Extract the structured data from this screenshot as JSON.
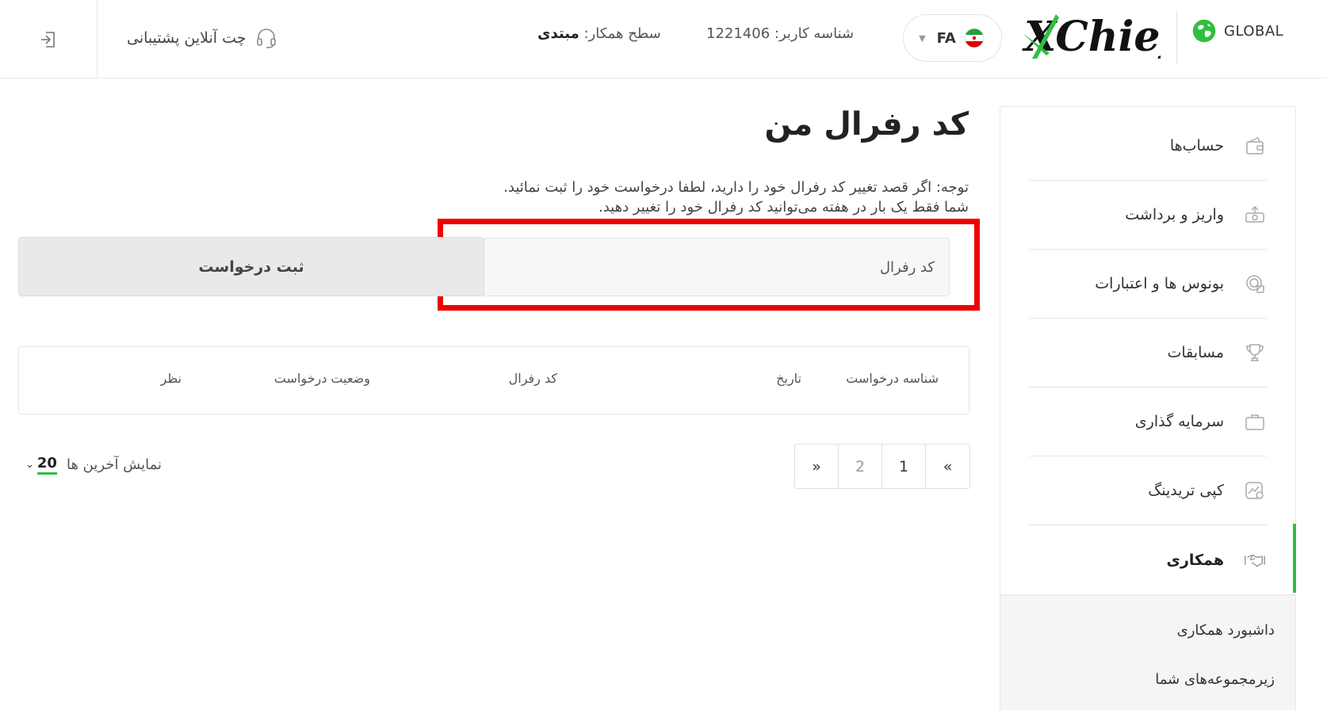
{
  "header": {
    "support_label": "چت آنلاین پشتیبانی",
    "partner_level_label": "سطح همکار:",
    "partner_level_value": "مبتدی",
    "user_id_text": "شناسه کاربر: 1221406",
    "language_code": "FA",
    "logo_text": "XChief",
    "global_label": "GLOBAL",
    "icons": {
      "logout": "logout-icon",
      "support": "headset-icon",
      "flag": "iran-flag-icon",
      "caret": "chevron-down-icon",
      "globe": "globe-icon"
    }
  },
  "main": {
    "title": "کد رفرال من",
    "notice_line1": "توجه: اگر قصد تغییر کد رفرال خود را دارید، لطفا درخواست خود را ثبت نمائید.",
    "notice_line2": "شما فقط یک بار در هفته می‌توانید کد رفرال خود را تغییر دهید.",
    "referral_input_placeholder": "کد رفرال",
    "submit_label": "ثبت درخواست",
    "table_headers": [
      "شناسه درخواست",
      "تاریخ",
      "کد رفرال",
      "وضعیت درخواست",
      "نظر"
    ],
    "pagination": {
      "next": "»",
      "pages": [
        "1",
        "2"
      ],
      "prev": "«"
    },
    "show_last_label": "نمایش آخرین ها",
    "show_last_value": "20"
  },
  "sidebar": {
    "items": [
      {
        "label": "حساب‌ها",
        "icon": "wallet-icon"
      },
      {
        "label": "واریز و برداشت",
        "icon": "money-transfer-icon"
      },
      {
        "label": "بونوس ها و اعتبارات",
        "icon": "bonus-coin-icon"
      },
      {
        "label": "مسابقات",
        "icon": "trophy-icon"
      },
      {
        "label": "سرمایه گذاری",
        "icon": "briefcase-icon"
      },
      {
        "label": "کپی تریدینگ",
        "icon": "copy-trading-icon"
      },
      {
        "label": "همکاری",
        "icon": "handshake-icon"
      }
    ],
    "active_index": 6,
    "submenu": [
      "داشبورد همکاری",
      "زیرمجموعه‌های شما"
    ]
  },
  "colors": {
    "accent_green": "#2fbf3f",
    "highlight_red": "#ee0000"
  }
}
